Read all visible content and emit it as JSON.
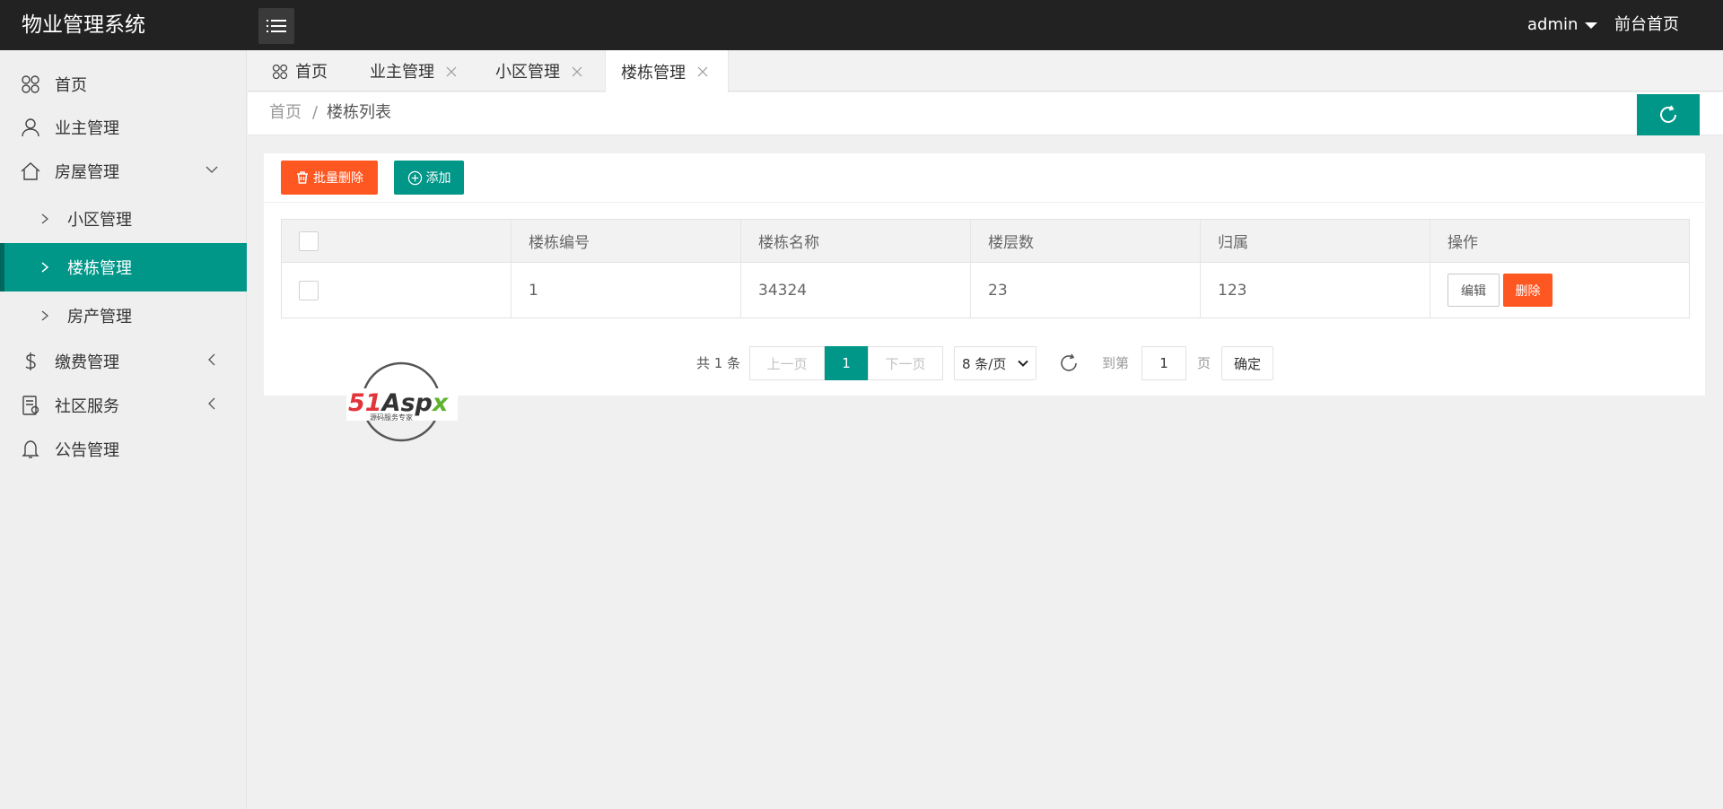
{
  "app": {
    "title": "物业管理系统"
  },
  "header": {
    "user": "admin",
    "front_home": "前台首页"
  },
  "sidebar": {
    "items": [
      {
        "label": "首页"
      },
      {
        "label": "业主管理"
      },
      {
        "label": "房屋管理"
      },
      {
        "label": "缴费管理"
      },
      {
        "label": "社区服务"
      },
      {
        "label": "公告管理"
      }
    ],
    "sub_items": [
      {
        "label": "小区管理"
      },
      {
        "label": "楼栋管理"
      },
      {
        "label": "房产管理"
      }
    ]
  },
  "tabs": [
    {
      "label": "首页"
    },
    {
      "label": "业主管理"
    },
    {
      "label": "小区管理"
    },
    {
      "label": "楼栋管理"
    }
  ],
  "breadcrumb": {
    "home": "首页",
    "separator": "/",
    "current": "楼栋列表"
  },
  "toolbar": {
    "batch_delete": "批量删除",
    "add": "添加"
  },
  "table": {
    "columns": [
      "楼栋编号",
      "楼栋名称",
      "楼层数",
      "归属",
      "操作"
    ],
    "rows": [
      {
        "id": "1",
        "name": "34324",
        "floors": "23",
        "owner": "123"
      }
    ],
    "edit_label": "编辑",
    "delete_label": "删除"
  },
  "pagination": {
    "total": "共 1 条",
    "prev": "上一页",
    "current": "1",
    "next": "下一页",
    "page_size": "8 条/页",
    "goto": "到第",
    "goto_value": "1",
    "page_unit": "页",
    "confirm": "确定"
  },
  "watermark": {
    "brand": "51Aspx",
    "slogan": "源码服务专家"
  },
  "colors": {
    "header_bg": "#222222",
    "primary": "#009688",
    "danger": "#ff5722",
    "sidebar_bg": "#efefef"
  }
}
